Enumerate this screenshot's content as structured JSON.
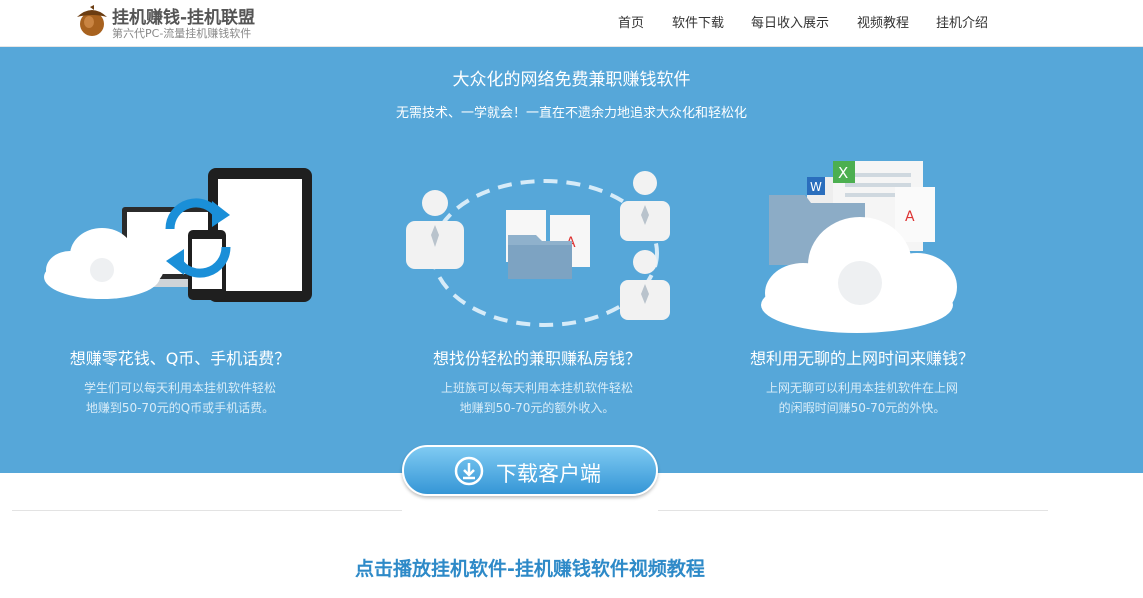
{
  "brand": {
    "title": "挂机赚钱-挂机联盟",
    "subtitle": "第六代PC-流量挂机赚钱软件",
    "logo_icon": "acorn-logo-icon"
  },
  "nav": {
    "items": [
      {
        "label": "首页"
      },
      {
        "label": "软件下载"
      },
      {
        "label": "每日收入展示"
      },
      {
        "label": "视频教程"
      },
      {
        "label": "挂机介绍"
      }
    ]
  },
  "hero": {
    "title": "大众化的网络免费兼职赚钱软件",
    "subtitle": "无需技术、一学就会！一直在不遗余力地追求大众化和轻松化",
    "background": "#56a7d9",
    "features": [
      {
        "icon": "devices-sync-cloud-icon",
        "title": "想赚零花钱、Q币、手机话费？",
        "desc_line1": "学生们可以每天利用本挂机软件轻松",
        "desc_line2": "地赚到50-70元的Q币或手机话费。"
      },
      {
        "icon": "users-share-folder-icon",
        "title": "想找份轻松的兼职赚私房钱？",
        "desc_line1": "上班族可以每天利用本挂机软件轻松",
        "desc_line2": "地赚到50-70元的额外收入。"
      },
      {
        "icon": "cloud-documents-icon",
        "title": "想利用无聊的上网时间来赚钱？",
        "desc_line1": "上网无聊可以利用本挂机软件在上网",
        "desc_line2": "的闲暇时间赚50-70元的外快。"
      }
    ]
  },
  "download": {
    "label": "下载客户端",
    "icon": "download-arrow-icon"
  },
  "video_section": {
    "title": "点击播放挂机软件-挂机赚钱软件视频教程",
    "color": "#2e8ac8"
  }
}
